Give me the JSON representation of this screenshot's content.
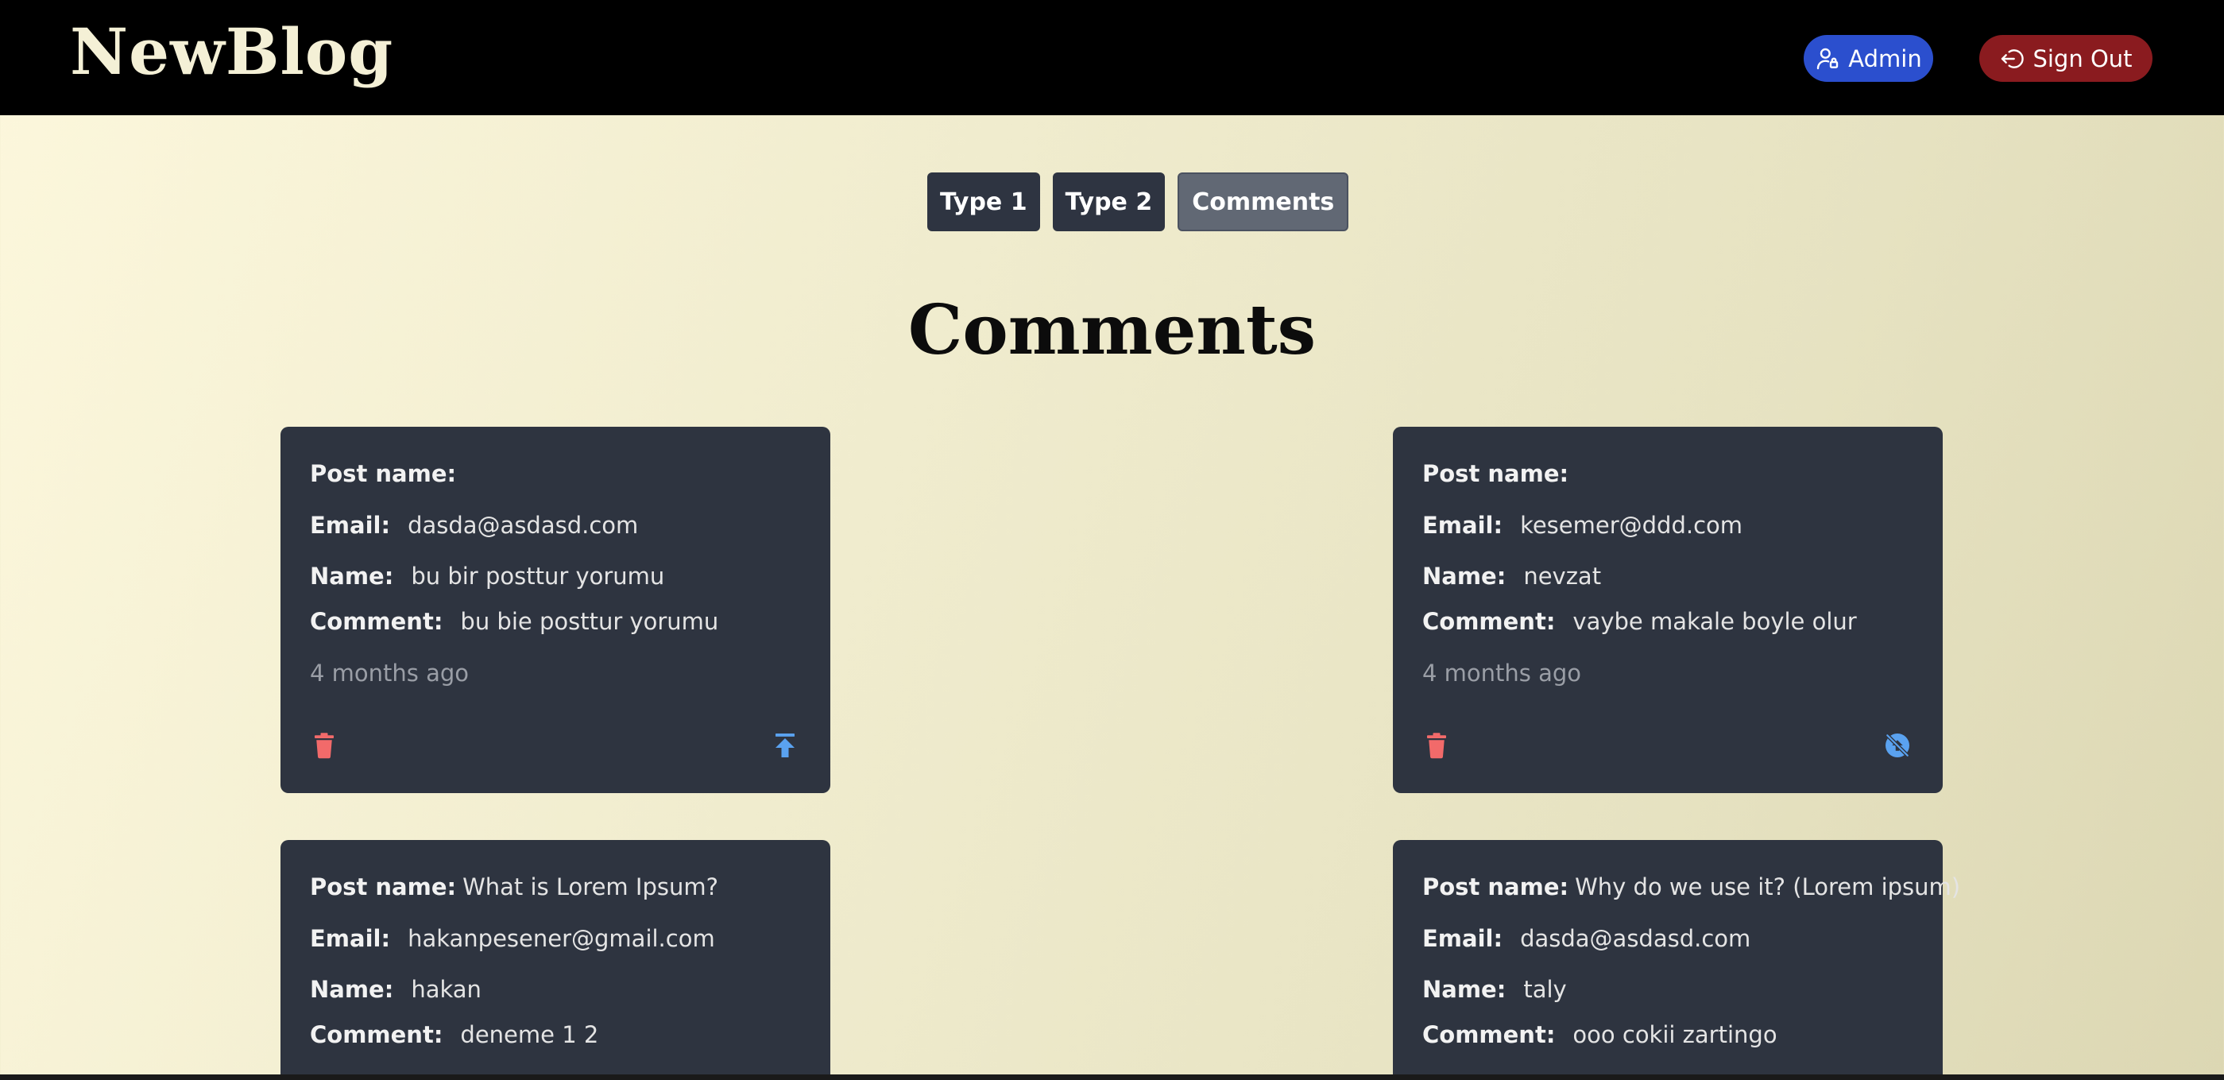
{
  "header": {
    "logo": "NewBlog",
    "admin_label": "Admin",
    "signout_label": "Sign Out"
  },
  "tabs": [
    {
      "label": "Type 1",
      "active": false
    },
    {
      "label": "Type 2",
      "active": false
    },
    {
      "label": "Comments",
      "active": true
    }
  ],
  "page_title": "Comments",
  "labels": {
    "post_name": "Post name:",
    "email": "Email:",
    "name": "Name:",
    "comment": "Comment:"
  },
  "comments": [
    {
      "post_name": "",
      "email": "dasda@asdasd.com",
      "name": "bu bir posttur yorumu",
      "comment": "bu bie posttur yorumu",
      "time": "4 months ago",
      "action_icon": "publish-icon"
    },
    {
      "post_name": "",
      "email": "kesemer@ddd.com",
      "name": "nevzat",
      "comment": "vaybe makale boyle olur",
      "time": "4 months ago",
      "action_icon": "unpublish-icon"
    },
    {
      "post_name": "What is Lorem Ipsum?",
      "email": "hakanpesener@gmail.com",
      "name": "hakan",
      "comment": "deneme 1 2",
      "time": "",
      "action_icon": ""
    },
    {
      "post_name": "Why do we use it? (Lorem ipsum)",
      "email": "dasda@asdasd.com",
      "name": "taly",
      "comment": "ooo cokii zartingo",
      "time": "",
      "action_icon": ""
    }
  ],
  "colors": {
    "header_bg": "#000000",
    "admin_blue": "#2b4fce",
    "signout_red": "#8a1b1f",
    "card_bg": "#2e3440",
    "delete_red": "#f26a6a",
    "action_blue": "#5aa2f0"
  }
}
